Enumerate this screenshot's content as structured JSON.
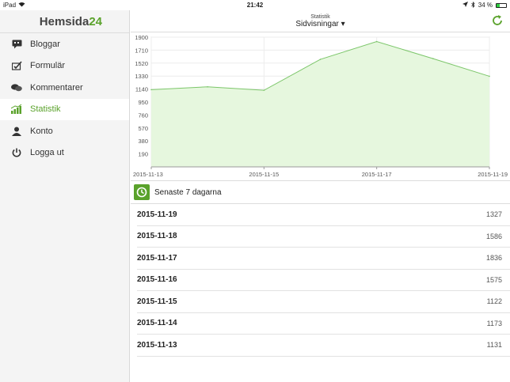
{
  "statusbar": {
    "device": "iPad",
    "time": "21:42",
    "battery": "34 %",
    "battery_level": 0.34
  },
  "sidebar": {
    "logo_main": "Hemsida",
    "logo_accent": "24",
    "items": [
      {
        "label": "Bloggar",
        "icon": "blog-icon"
      },
      {
        "label": "Formulär",
        "icon": "form-icon"
      },
      {
        "label": "Kommentarer",
        "icon": "comments-icon"
      },
      {
        "label": "Statistik",
        "icon": "stats-icon",
        "active": true
      },
      {
        "label": "Konto",
        "icon": "user-icon"
      },
      {
        "label": "Logga ut",
        "icon": "power-icon"
      }
    ]
  },
  "header": {
    "subtitle": "Statistik",
    "title": "Sidvisningar ▾"
  },
  "colors": {
    "accent": "#5aa22b",
    "chart_fill": "#e6f7de",
    "chart_line": "#7cc66a"
  },
  "chart_data": {
    "type": "area",
    "x": [
      "2015-11-13",
      "2015-11-14",
      "2015-11-15",
      "2015-11-16",
      "2015-11-17",
      "2015-11-18",
      "2015-11-19"
    ],
    "values": [
      1131,
      1173,
      1122,
      1575,
      1836,
      1586,
      1327
    ],
    "xticks": [
      "2015-11-13",
      "2015-11-15",
      "2015-11-17",
      "2015-11-19"
    ],
    "yticks": [
      190,
      380,
      570,
      760,
      950,
      1140,
      1330,
      1520,
      1710,
      1900
    ],
    "ylim": [
      0,
      1900
    ],
    "grid": true
  },
  "recent": {
    "title": "Senaste 7 dagarna",
    "rows": [
      {
        "date": "2015-11-19",
        "value": "1327"
      },
      {
        "date": "2015-11-18",
        "value": "1586"
      },
      {
        "date": "2015-11-17",
        "value": "1836"
      },
      {
        "date": "2015-11-16",
        "value": "1575"
      },
      {
        "date": "2015-11-15",
        "value": "1122"
      },
      {
        "date": "2015-11-14",
        "value": "1173"
      },
      {
        "date": "2015-11-13",
        "value": "1131"
      }
    ]
  }
}
